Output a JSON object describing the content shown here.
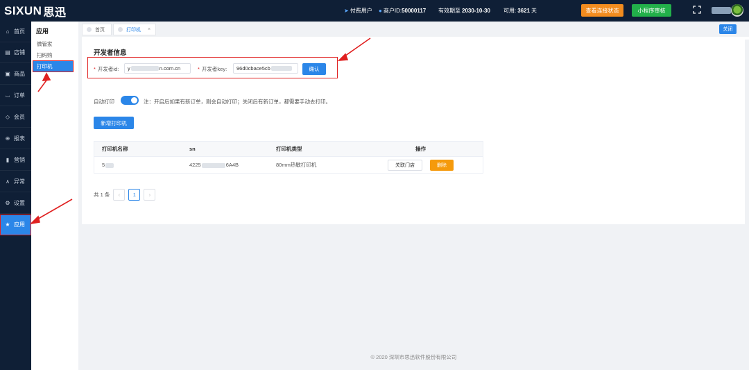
{
  "header": {
    "logo_text": "SIXUN",
    "logo_cn": "思迅",
    "user_type": "付费用户",
    "merchant_label": "商户ID:",
    "merchant_id": "50000117",
    "valid_label": "有效期至",
    "valid_date": "2030-10-30",
    "available_label": "可用:",
    "available_value": "3621",
    "available_unit": "天",
    "btn_connection": "查看连接状态",
    "btn_miniapp": "小程序审核"
  },
  "sidebar": {
    "items": [
      {
        "label": "首页",
        "icon": "home-icon",
        "glyph": "⌂"
      },
      {
        "label": "店铺",
        "icon": "store-icon",
        "glyph": "▤"
      },
      {
        "label": "商品",
        "icon": "gift-icon",
        "glyph": "▣"
      },
      {
        "label": "订单",
        "icon": "order-icon",
        "glyph": "⌴"
      },
      {
        "label": "会员",
        "icon": "member-icon",
        "glyph": "◇"
      },
      {
        "label": "报表",
        "icon": "report-icon",
        "glyph": "⊕"
      },
      {
        "label": "营销",
        "icon": "marketing-icon",
        "glyph": "▮"
      },
      {
        "label": "异常",
        "icon": "warning-icon",
        "glyph": "∧"
      },
      {
        "label": "设置",
        "icon": "settings-icon",
        "glyph": "⚙"
      },
      {
        "label": "应用",
        "icon": "star-icon",
        "glyph": "★"
      }
    ]
  },
  "submenu": {
    "title": "应用",
    "items": [
      "微管家",
      "扫码购",
      "打印机"
    ]
  },
  "tabs": {
    "items": [
      "首页",
      "打印机"
    ],
    "close_label": "关闭"
  },
  "developer": {
    "title": "开发者信息",
    "id_label": "开发者id:",
    "id_value_prefix": "y",
    "id_value_suffix": "n.com.cn",
    "key_label": "开发者key:",
    "key_value_prefix": "96d0cbace5cb",
    "confirm": "确认"
  },
  "auto_print": {
    "label": "自动打印",
    "enabled": true,
    "note": "注：开启后如果有新订单，则会自动打印；关闭后有新订单，都需要手动去打印。"
  },
  "add_button": "新增打印机",
  "table": {
    "headers": [
      "打印机名称",
      "sn",
      "打印机类型",
      "操作"
    ],
    "rows": [
      {
        "name": "5",
        "sn_prefix": "4225",
        "sn_suffix": "6A4B",
        "type": "80mm热敏打印机",
        "btn_link": "关联门店",
        "btn_delete": "删除"
      }
    ]
  },
  "pagination": {
    "total": "共 1 条",
    "prev": "‹",
    "current": "1",
    "next": "›"
  },
  "footer": "© 2020 深圳市思迅软件股份有限公司",
  "colors": {
    "sidebar_bg": "#0f1f36",
    "primary": "#2b86e8",
    "orange": "#f28c1f",
    "green": "#22b04a",
    "annotation": "#e02020"
  }
}
